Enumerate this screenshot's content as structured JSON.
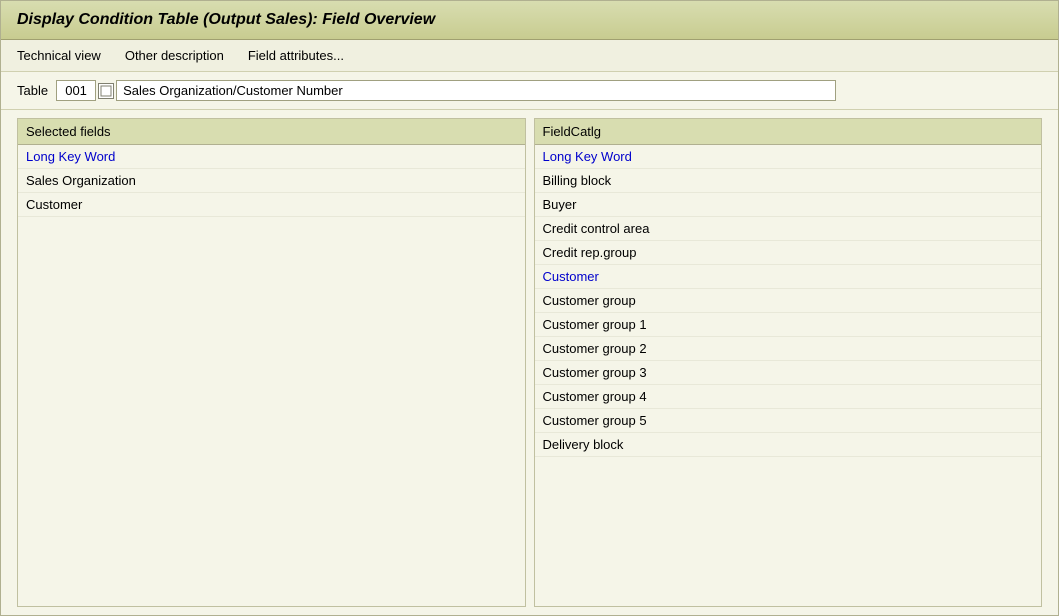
{
  "title": "Display Condition Table (Output Sales): Field Overview",
  "menu": {
    "items": [
      {
        "label": "Technical view",
        "id": "technical-view"
      },
      {
        "label": "Other description",
        "id": "other-description"
      },
      {
        "label": "Field attributes...",
        "id": "field-attributes"
      }
    ]
  },
  "table_field": {
    "label": "Table",
    "number": "001",
    "description": "Sales Organization/Customer Number"
  },
  "left_panel": {
    "header": "Selected fields",
    "items": [
      {
        "label": "Long Key Word",
        "type": "highlighted"
      },
      {
        "label": "Sales Organization",
        "type": "normal"
      },
      {
        "label": "Customer",
        "type": "normal"
      }
    ]
  },
  "right_panel": {
    "header": "FieldCatlg",
    "items": [
      {
        "label": "Long Key Word",
        "type": "highlighted"
      },
      {
        "label": "Billing block",
        "type": "normal"
      },
      {
        "label": "Buyer",
        "type": "normal"
      },
      {
        "label": "Credit control area",
        "type": "normal"
      },
      {
        "label": "Credit rep.group",
        "type": "normal"
      },
      {
        "label": "Customer",
        "type": "highlighted"
      },
      {
        "label": "Customer group",
        "type": "normal"
      },
      {
        "label": "Customer group 1",
        "type": "normal"
      },
      {
        "label": "Customer group 2",
        "type": "normal"
      },
      {
        "label": "Customer group 3",
        "type": "normal"
      },
      {
        "label": "Customer group 4",
        "type": "normal"
      },
      {
        "label": "Customer group 5",
        "type": "normal"
      },
      {
        "label": "Delivery block",
        "type": "normal"
      }
    ]
  }
}
